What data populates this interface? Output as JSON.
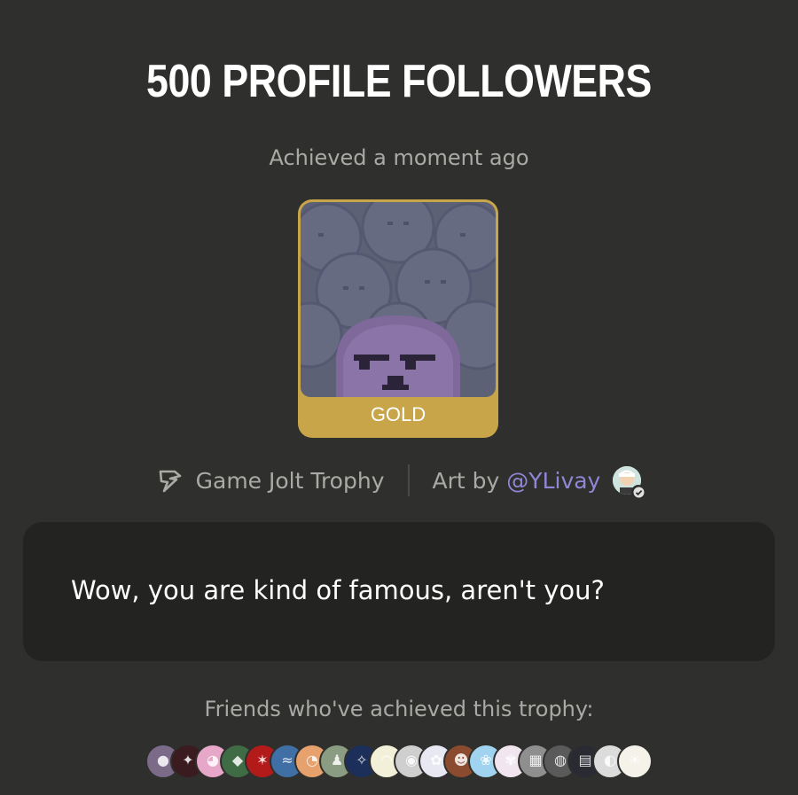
{
  "trophy": {
    "title": "500 PROFILE FOLLOWERS",
    "achieved": "Achieved a moment ago",
    "tier": "GOLD",
    "description": "Wow, you are kind of famous, aren't you?"
  },
  "meta": {
    "trophy_type": "Game Jolt Trophy",
    "art_by_prefix": "Art by",
    "artist_handle": "@YLivay"
  },
  "friends": {
    "label": "Friends who've achieved this trophy:",
    "avatars": [
      {
        "color": "#7b6a88",
        "glyph": "●"
      },
      {
        "color": "#3a1b1f",
        "glyph": "✦"
      },
      {
        "color": "#e7a7c9",
        "glyph": "◕"
      },
      {
        "color": "#3f6b45",
        "glyph": "◆"
      },
      {
        "color": "#b31b1b",
        "glyph": "✶"
      },
      {
        "color": "#3f6fa5",
        "glyph": "≈"
      },
      {
        "color": "#e6a16c",
        "glyph": "◔"
      },
      {
        "color": "#8a9c82",
        "glyph": "♟"
      },
      {
        "color": "#1b2f5a",
        "glyph": "✧"
      },
      {
        "color": "#f2f0d8",
        "glyph": "◠"
      },
      {
        "color": "#cfcfcf",
        "glyph": "◉"
      },
      {
        "color": "#e8e8f3",
        "glyph": "✿"
      },
      {
        "color": "#8a4b2f",
        "glyph": "☻"
      },
      {
        "color": "#9fd3ef",
        "glyph": "❀"
      },
      {
        "color": "#f1e6f0",
        "glyph": "✾"
      },
      {
        "color": "#8f8f8f",
        "glyph": "▦"
      },
      {
        "color": "#5a5a5a",
        "glyph": "◍"
      },
      {
        "color": "#2a2a33",
        "glyph": "▤"
      },
      {
        "color": "#dcdcdc",
        "glyph": "◐"
      },
      {
        "color": "#f5f2ea",
        "glyph": "☀"
      }
    ]
  },
  "colors": {
    "background": "#2f2f2d",
    "card": "#232321",
    "gold": "#c9a54a",
    "link": "#8f86d6",
    "muted": "#a9a9a5"
  },
  "icons": [
    "game-jolt-bolt-icon",
    "verified-icon"
  ]
}
